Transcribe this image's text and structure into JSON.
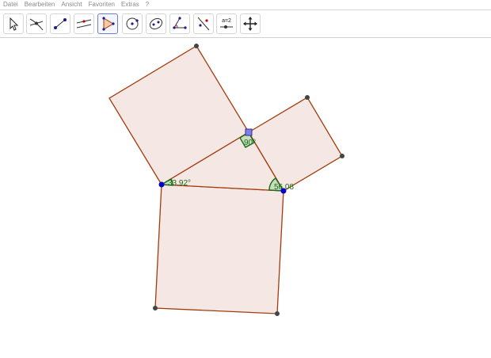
{
  "menu": [
    "Datei",
    "Bearbeiten",
    "Ansicht",
    "Favoriten",
    "Extras",
    "?"
  ],
  "toolbar": {
    "tools": [
      {
        "name": "move-tool",
        "icon": "arrow-pointer-icon"
      },
      {
        "name": "point-tool",
        "icon": "intersect-point-icon"
      },
      {
        "name": "line-tool",
        "icon": "segment-icon"
      },
      {
        "name": "parallel-line-tool",
        "icon": "parallel-line-icon"
      },
      {
        "name": "polygon-tool",
        "icon": "polygon-icon",
        "active": true
      },
      {
        "name": "circle-tool",
        "icon": "circle-center-icon"
      },
      {
        "name": "conic-tool",
        "icon": "ellipse-icon"
      },
      {
        "name": "angle-tool",
        "icon": "angle-icon"
      },
      {
        "name": "reflect-tool",
        "icon": "reflect-line-icon"
      },
      {
        "name": "slider-tool",
        "icon": "slider-icon",
        "label": "a=2"
      },
      {
        "name": "move-view-tool",
        "icon": "move-view-icon"
      }
    ]
  },
  "construction": {
    "angles": {
      "right": "90°",
      "left": "33.92°",
      "right_base": "56.08"
    },
    "colors": {
      "fill": "#f5e8e4",
      "stroke": "#a23b0c",
      "point": "#0000cc",
      "free_point": "#444444",
      "angle": "#1a6b1a",
      "selected_point": "#8080e0"
    }
  }
}
